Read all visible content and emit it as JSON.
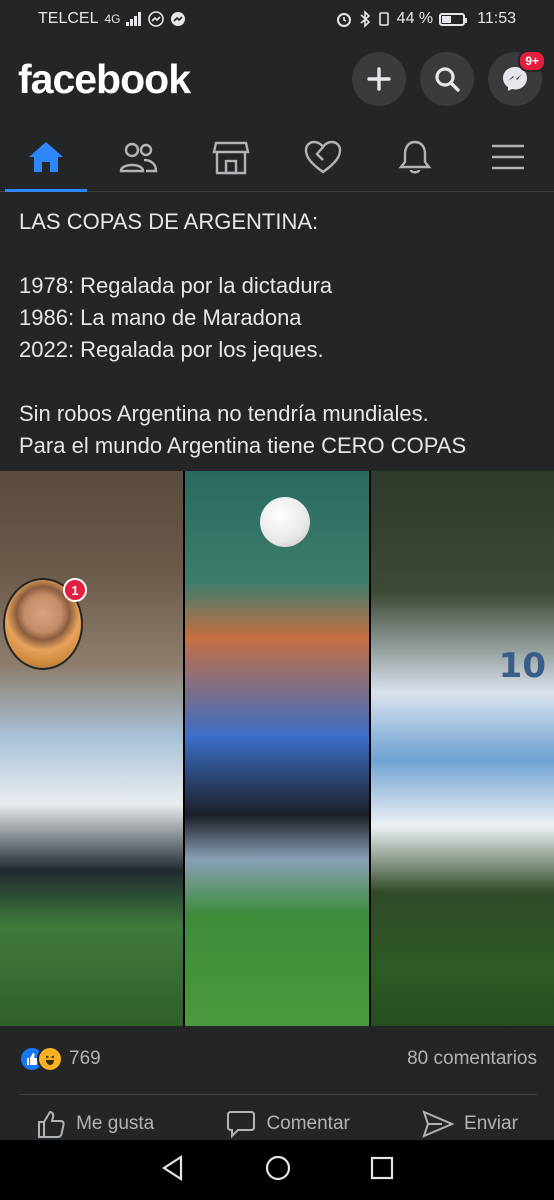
{
  "status_bar": {
    "carrier": "TELCEL",
    "network": "4G",
    "battery_percent": "44 %",
    "battery_level": 0.44,
    "time": "11:53"
  },
  "header": {
    "logo": "facebook",
    "messenger_badge": "9+"
  },
  "nav_tabs": [
    "home",
    "friends",
    "marketplace",
    "dating",
    "notifications",
    "menu"
  ],
  "post": {
    "lines": [
      "LAS COPAS DE ARGENTINA:",
      "",
      "1978: Regalada por la dictadura",
      "1986: La mano de Maradona",
      "2022: Regalada por los jeques.",
      "",
      "Sin robos Argentina no tendría mundiales.",
      "Para el mundo Argentina tiene CERO COPAS"
    ],
    "chathead_badge": "1",
    "jersey_number": "10"
  },
  "reactions": {
    "count": "769",
    "comments": "80 comentarios"
  },
  "actions": {
    "like": "Me gusta",
    "comment": "Comentar",
    "send": "Enviar"
  },
  "colors": {
    "background": "#242526",
    "accent": "#2d88ff",
    "badge": "#e41e3f"
  }
}
